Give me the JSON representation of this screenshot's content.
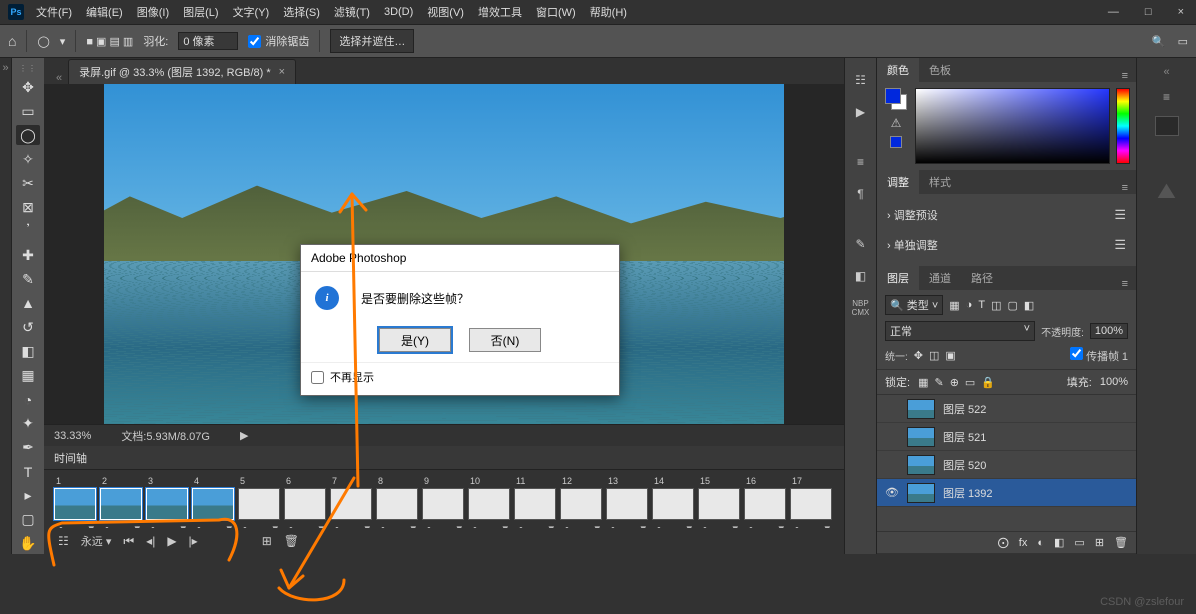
{
  "app": {
    "name": "Ps"
  },
  "menu": [
    "文件(F)",
    "编辑(E)",
    "图像(I)",
    "图层(L)",
    "文字(Y)",
    "选择(S)",
    "滤镜(T)",
    "3D(D)",
    "视图(V)",
    "增效工具",
    "窗口(W)",
    "帮助(H)"
  ],
  "win_controls": {
    "min": "—",
    "max": "□",
    "close": "×"
  },
  "optbar": {
    "home": "⌂",
    "lasso": "◯",
    "swatch_icons": [
      "■",
      "▣",
      "▤",
      "▥"
    ],
    "feather_label": "羽化:",
    "feather_value": "0 像素",
    "antialias": "消除锯齿",
    "select_mask": "选择并遮住…",
    "search": "🔍",
    "workspace": "▭"
  },
  "doc_tab": {
    "title": "录屏.gif @ 33.3% (图层 1392, RGB/8) *",
    "close": "×"
  },
  "status": {
    "zoom": "33.33%",
    "doc": "文档:5.93M/8.07G",
    "arrow": "▶"
  },
  "dialog": {
    "title": "Adobe Photoshop",
    "message": "是否要删除这些帧？",
    "yes": "是(Y)",
    "no": "否(N)",
    "dont_show": "不再显示"
  },
  "timeline": {
    "title": "时间轴",
    "frames": [
      {
        "n": "1",
        "sel": true,
        "blank": false
      },
      {
        "n": "2",
        "sel": true,
        "blank": false
      },
      {
        "n": "3",
        "sel": true,
        "blank": false
      },
      {
        "n": "4",
        "sel": true,
        "blank": false
      },
      {
        "n": "5",
        "sel": false,
        "blank": true
      },
      {
        "n": "6",
        "sel": false,
        "blank": true
      },
      {
        "n": "7",
        "sel": false,
        "blank": true
      },
      {
        "n": "8",
        "sel": false,
        "blank": true
      },
      {
        "n": "9",
        "sel": false,
        "blank": true
      },
      {
        "n": "10",
        "sel": false,
        "blank": true
      },
      {
        "n": "11",
        "sel": false,
        "blank": true
      },
      {
        "n": "12",
        "sel": false,
        "blank": true
      },
      {
        "n": "13",
        "sel": false,
        "blank": true
      },
      {
        "n": "14",
        "sel": false,
        "blank": true
      },
      {
        "n": "15",
        "sel": false,
        "blank": true
      },
      {
        "n": "16",
        "sel": false,
        "blank": true
      },
      {
        "n": "17",
        "sel": false,
        "blank": true
      }
    ],
    "delay_icon": ".•.",
    "delay_caret": "▾",
    "ctrl": {
      "conv": "☷",
      "loop": "永远",
      "loop_caret": "▾",
      "first": "⏮",
      "prev_kf": "◂|",
      "play": "▶",
      "next_kf": "|▸",
      "tween": "⧉",
      "dup": "⊞",
      "trash": "🗑"
    }
  },
  "panels": {
    "color": {
      "tab1": "颜色",
      "tab2": "色板",
      "warn": "⚠"
    },
    "adjust": {
      "tab1": "调整",
      "tab2": "样式",
      "row1": "调整预设",
      "row2": "单独调整",
      "list_icon": "☰"
    },
    "layers": {
      "tab1": "图层",
      "tab2": "通道",
      "tab3": "路径",
      "kind_label": "🔍 类型",
      "kind_caret": "˅",
      "filter_icons": [
        "▦",
        "◑",
        "T",
        "◫",
        "▢",
        "◧"
      ],
      "blend": "正常",
      "blend_caret": "˅",
      "opacity_label": "不透明度:",
      "opacity": "100%",
      "unify": "统一:",
      "unify_icons": [
        "✥",
        "◫",
        "▣"
      ],
      "propagate": "传播帧",
      "propagate_value": "1",
      "lock_label": "锁定:",
      "lock_icons": [
        "▦",
        "✎",
        "⊕",
        "▭",
        "🔒"
      ],
      "fill_label": "填充:",
      "fill": "100%",
      "rows": [
        {
          "name": "图层 522",
          "sel": false,
          "eye": ""
        },
        {
          "name": "图层 521",
          "sel": false,
          "eye": ""
        },
        {
          "name": "图层 520",
          "sel": false,
          "eye": ""
        },
        {
          "name": "图层 1392",
          "sel": true,
          "eye": "👁"
        }
      ],
      "footer": [
        "⨀",
        "fx",
        "◐",
        "◧",
        "▭",
        "⊞",
        "🗑"
      ]
    }
  },
  "rightstrip": {
    "nbp": "NBP\nCMX"
  },
  "watermark": "CSDN @zslefour"
}
